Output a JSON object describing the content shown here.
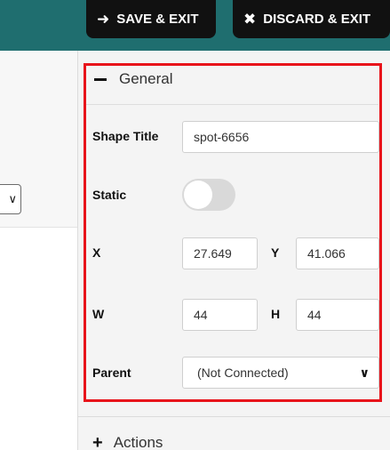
{
  "toolbar": {
    "save_label": "SAVE & EXIT",
    "save_icon": "arrow-right-icon",
    "discard_label": "DISCARD & EXIT",
    "discard_icon": "x-icon"
  },
  "general": {
    "title": "General",
    "shape_title_label": "Shape Title",
    "shape_title_value": "spot-6656",
    "static_label": "Static",
    "static_on": false,
    "x_label": "X",
    "x_value": "27.649",
    "y_label": "Y",
    "y_value": "41.066",
    "w_label": "W",
    "w_value": "44",
    "h_label": "H",
    "h_value": "44",
    "parent_label": "Parent",
    "parent_value": "(Not Connected)"
  },
  "actions": {
    "title": "Actions"
  },
  "colors": {
    "topbar": "#1f6e6f",
    "highlight": "#e8141b"
  }
}
